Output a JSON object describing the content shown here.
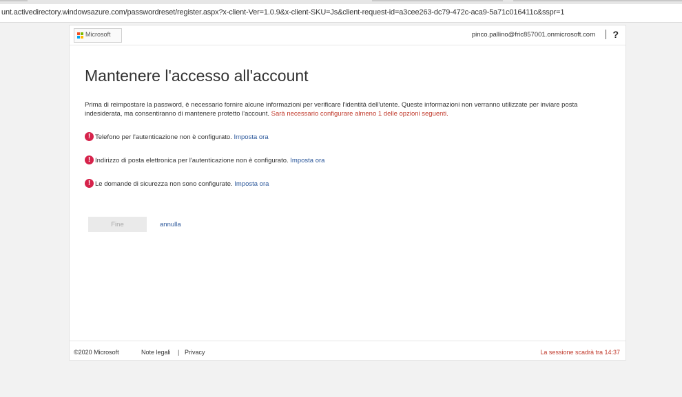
{
  "browser": {
    "url": "unt.activedirectory.windowsazure.com/passwordreset/register.aspx?x-client-Ver=1.0.9&x-client-SKU=Js&client-request-id=a3cee263-dc79-472c-aca9-5a71c016411c&sspr=1"
  },
  "header": {
    "logo_text": "Microsoft",
    "user_email": "pinco.pallino@fric857001.onmicrosoft.com",
    "help_label": "?"
  },
  "main": {
    "title": "Mantenere l'accesso all'account",
    "intro_text": "Prima di reimpostare la password, è necessario fornire alcune informazioni per verificare l'identità dell'utente. Queste informazioni non verranno utilizzate per inviare posta indesiderata, ma consentiranno di mantenere protetto l'account.",
    "intro_warning": "Sarà necessario configurare almeno 1 delle opzioni seguenti.",
    "requirements": [
      {
        "text": "Telefono per l'autenticazione non è configurato.",
        "link": "Imposta ora"
      },
      {
        "text": "Indirizzo di posta elettronica per l'autenticazione non è configurato.",
        "link": "Imposta ora"
      },
      {
        "text": "Le domande di sicurezza non sono configurate.",
        "link": "Imposta ora"
      }
    ],
    "finish_label": "Fine",
    "cancel_label": "annulla"
  },
  "footer": {
    "copyright": "©2020 Microsoft",
    "legal_label": "Note legali",
    "separator": "|",
    "privacy_label": "Privacy",
    "session_text": "La sessione scadrà tra 14:37"
  },
  "colors": {
    "alert": "#d6234b",
    "warning_text": "#c0392b",
    "link": "#2b579a",
    "ms_red": "#f25022",
    "ms_green": "#7fba00",
    "ms_blue": "#00a4ef",
    "ms_yellow": "#ffb900"
  },
  "icons": {
    "alert": "exclamation-circle-icon",
    "logo": "microsoft-logo-icon"
  }
}
